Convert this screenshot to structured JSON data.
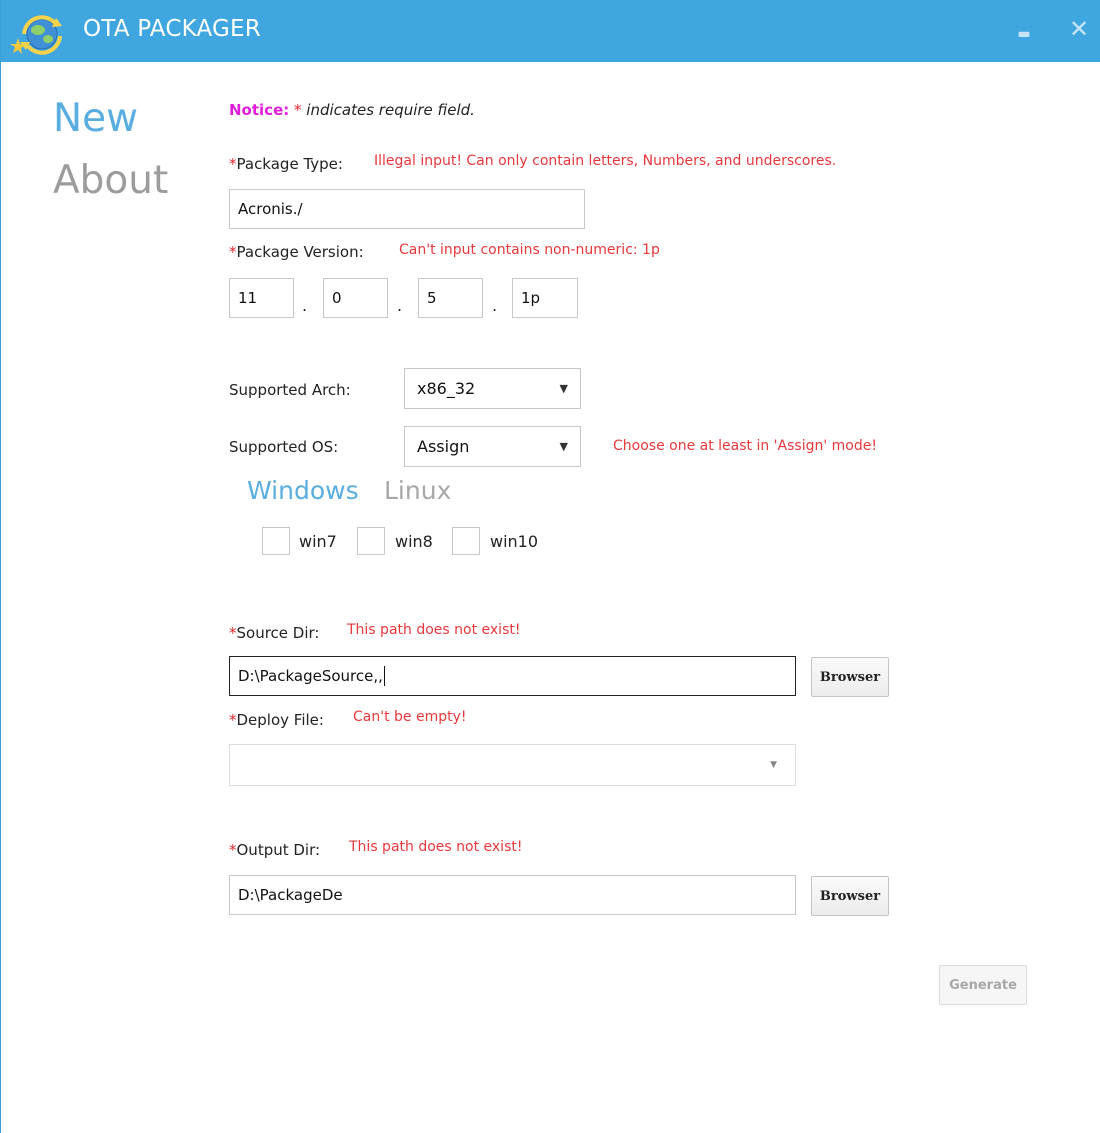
{
  "window": {
    "title": "OTA PACKAGER",
    "minimize_glyph": "▬",
    "close_glyph": "✕",
    "accent_color": "#40a6df"
  },
  "nav": {
    "items": [
      {
        "label": "New",
        "active": true
      },
      {
        "label": "About",
        "active": false
      }
    ]
  },
  "notice": {
    "label": "Notice:",
    "star": "*",
    "text": "indicates require field."
  },
  "form": {
    "package_type": {
      "required_mark": "*",
      "label": "Package Type:",
      "error": "Illegal input! Can only contain letters, Numbers, and underscores.",
      "value": "Acronis./"
    },
    "package_version": {
      "required_mark": "*",
      "label": "Package Version:",
      "error": "Can't input contains non-numeric: 1p",
      "parts": [
        "11",
        "0",
        "5",
        "1p"
      ],
      "separator": "."
    },
    "supported_arch": {
      "label": "Supported Arch:",
      "selected": "x86_32"
    },
    "supported_os": {
      "label": "Supported OS:",
      "selected": "Assign",
      "error": "Choose one at least in 'Assign' mode!",
      "tabs": [
        {
          "label": "Windows",
          "active": true
        },
        {
          "label": "Linux",
          "active": false
        }
      ],
      "options": [
        {
          "label": "win7",
          "checked": false
        },
        {
          "label": "win8",
          "checked": false
        },
        {
          "label": "win10",
          "checked": false
        }
      ]
    },
    "source_dir": {
      "required_mark": "*",
      "label": "Source Dir:",
      "error": "This path does not exist!",
      "value": "D:\\PackageSource,,",
      "button": "Browser"
    },
    "deploy_file": {
      "required_mark": "*",
      "label": "Deploy File:",
      "error": "Can't be empty!",
      "selected": ""
    },
    "output_dir": {
      "required_mark": "*",
      "label": "Output Dir:",
      "error": "This path does not exist!",
      "value": "D:\\PackageDe",
      "button": "Browser"
    },
    "generate_button": "Generate",
    "generate_enabled": false
  },
  "icons": {
    "app": "globe-arrows-icon",
    "dropdown": "triangle-down-icon"
  }
}
